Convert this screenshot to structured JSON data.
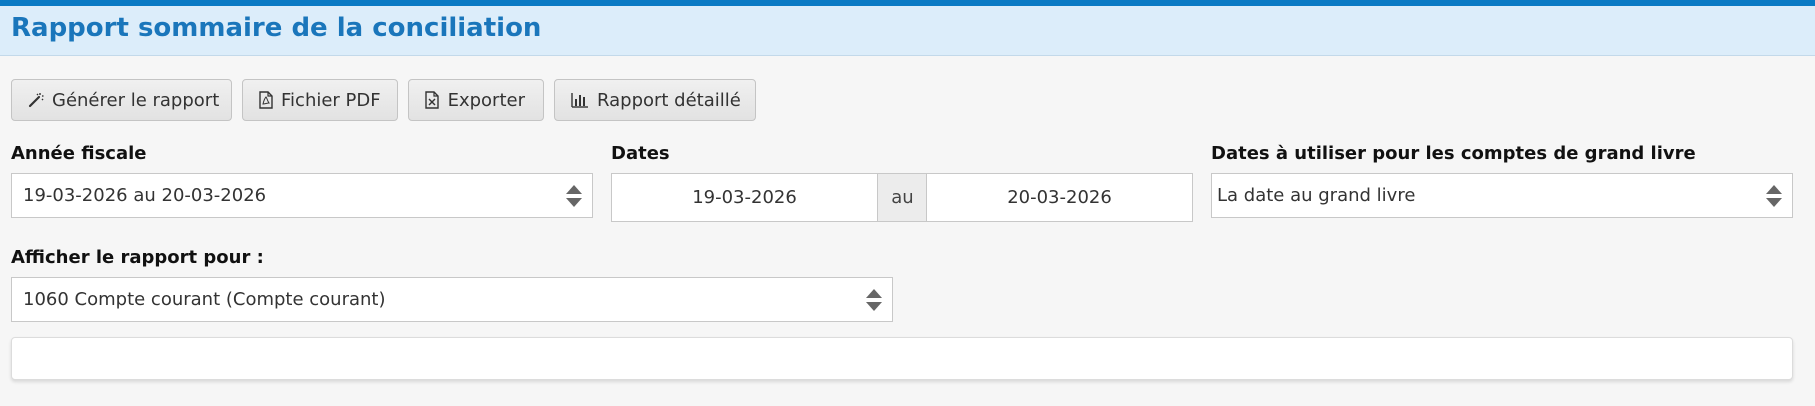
{
  "header": {
    "title": "Rapport sommaire de la conciliation",
    "accent_color": "#0a7ac4",
    "background_color": "#dcedfa"
  },
  "toolbar": {
    "generate": {
      "label": "Générer le rapport",
      "icon": "magic-wand-icon"
    },
    "pdf": {
      "label": "Fichier PDF",
      "icon": "pdf-file-icon"
    },
    "export": {
      "label": "Exporter",
      "icon": "excel-file-icon"
    },
    "detailed": {
      "label": "Rapport détaillé",
      "icon": "bar-chart-icon"
    }
  },
  "filters": {
    "fiscal_year": {
      "label": "Année fiscale",
      "value": "19-03-2026 au 20-03-2026"
    },
    "dates": {
      "label": "Dates",
      "from": "19-03-2026",
      "separator": "au",
      "to": "20-03-2026"
    },
    "ledger_dates": {
      "label": "Dates à utiliser pour les comptes de grand livre",
      "value": "La date au grand livre"
    },
    "report_for": {
      "label": "Afficher le rapport pour :",
      "value": "1060 Compte courant (Compte courant)"
    }
  }
}
